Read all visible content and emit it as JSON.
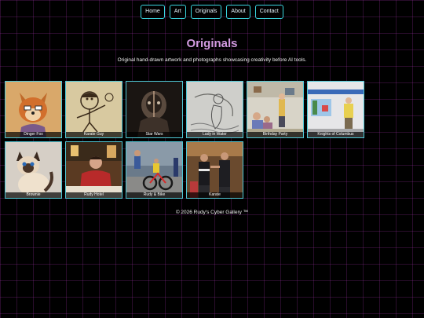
{
  "nav": {
    "items": [
      {
        "label": "Home"
      },
      {
        "label": "Art"
      },
      {
        "label": "Originals"
      },
      {
        "label": "About"
      },
      {
        "label": "Contact"
      }
    ]
  },
  "page": {
    "title": "Originals",
    "subtitle": "Original hand-drawn artwork and photographs showcasing creativity before AI tools."
  },
  "gallery": {
    "items": [
      {
        "caption": "Dinger Fox"
      },
      {
        "caption": "Karate Guy"
      },
      {
        "caption": "Star Wars"
      },
      {
        "caption": "Lady in Water"
      },
      {
        "caption": "Birthday Party"
      },
      {
        "caption": "Knights of Columbus"
      },
      {
        "caption": "Brownie"
      },
      {
        "caption": "Rudy Hotel"
      },
      {
        "caption": "Rudy & Bike"
      },
      {
        "caption": "Karate"
      }
    ]
  },
  "footer": {
    "text": "© 2026 Rudy's Cyber Gallery ™"
  },
  "colors": {
    "accent": "#3ad6e0",
    "title": "#d29ae0",
    "grid": "#be3cc8"
  }
}
